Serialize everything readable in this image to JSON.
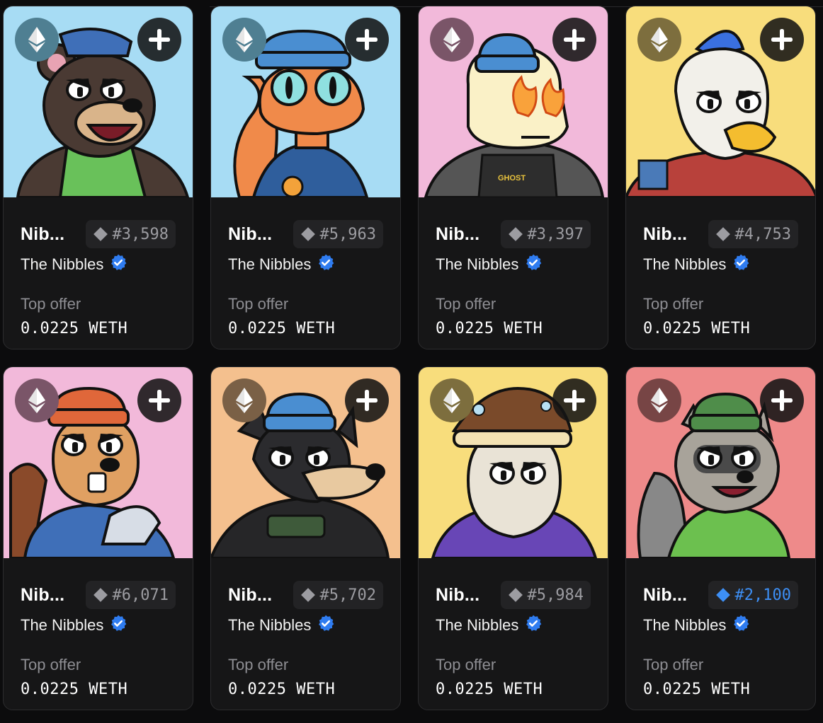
{
  "currency_icon": "ethereum-icon",
  "add_icon": "plus-icon",
  "verified_icon": "verified-badge-icon",
  "cards": [
    {
      "name": "Nib...",
      "rank": "#3,598",
      "rank_rare": false,
      "collection": "The Nibbles",
      "offer_label": "Top offer",
      "offer_value": "0.0225 WETH",
      "background": "#a7dcf4",
      "badge_color": "#4f7f92",
      "character": "bear"
    },
    {
      "name": "Nib...",
      "rank": "#5,963",
      "rank_rare": false,
      "collection": "The Nibbles",
      "offer_label": "Top offer",
      "offer_value": "0.0225 WETH",
      "background": "#a7dcf4",
      "badge_color": "#4f7f92",
      "character": "lizard"
    },
    {
      "name": "Nib...",
      "rank": "#3,397",
      "rank_rare": false,
      "collection": "The Nibbles",
      "offer_label": "Top offer",
      "offer_value": "0.0225 WETH",
      "background": "#f2b9da",
      "badge_color": "#7a5568",
      "character": "ghost"
    },
    {
      "name": "Nib...",
      "rank": "#4,753",
      "rank_rare": false,
      "collection": "The Nibbles",
      "offer_label": "Top offer",
      "offer_value": "0.0225 WETH",
      "background": "#f8dd7c",
      "badge_color": "#7d6e3e",
      "character": "eagle"
    },
    {
      "name": "Nib...",
      "rank": "#6,071",
      "rank_rare": false,
      "collection": "The Nibbles",
      "offer_label": "Top offer",
      "offer_value": "0.0225 WETH",
      "background": "#f2b9da",
      "badge_color": "#7a5568",
      "character": "beaver"
    },
    {
      "name": "Nib...",
      "rank": "#5,702",
      "rank_rare": false,
      "collection": "The Nibbles",
      "offer_label": "Top offer",
      "offer_value": "0.0225 WETH",
      "background": "#f4c08e",
      "badge_color": "#7a6046",
      "character": "wolf"
    },
    {
      "name": "Nib...",
      "rank": "#5,984",
      "rank_rare": false,
      "collection": "The Nibbles",
      "offer_label": "Top offer",
      "offer_value": "0.0225 WETH",
      "background": "#f8dd7c",
      "badge_color": "#7d6e3e",
      "character": "wizard"
    },
    {
      "name": "Nib...",
      "rank": "#2,100",
      "rank_rare": true,
      "collection": "The Nibbles",
      "offer_label": "Top offer",
      "offer_value": "0.0225 WETH",
      "background": "#ee8a8a",
      "badge_color": "#774545",
      "character": "raccoon"
    }
  ]
}
